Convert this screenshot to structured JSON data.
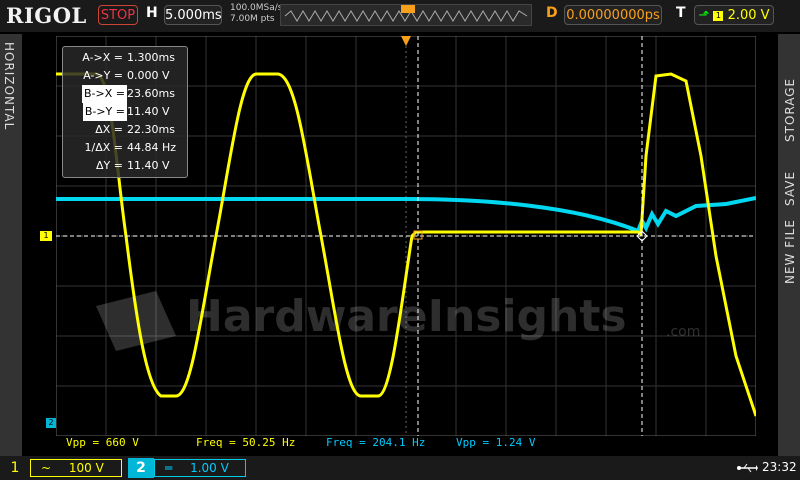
{
  "header": {
    "logo": "RIGOL",
    "run_state": "STOP",
    "h_label": "H",
    "timebase": "5.000ms",
    "sample_rate": "100.0MSa/s",
    "mem_depth": "7.00M pts",
    "d_label": "D",
    "delay": "0.00000000ps",
    "t_label": "T",
    "trigger_level": "2.00 V",
    "colors": {
      "stop": "#e33",
      "delay": "#f9a01a",
      "trigger": "#ffff00"
    }
  },
  "sidebar_left": {
    "label": "HORIZONTAL"
  },
  "sidebar_right": {
    "items": [
      "STORAGE",
      "SAVE",
      "NEW FILE"
    ]
  },
  "cursor_panel": {
    "rows": [
      {
        "label": "A->X =",
        "value": "1.300ms"
      },
      {
        "label": "A->Y =",
        "value": "0.000 V"
      },
      {
        "label": "B->X =",
        "value": "23.60ms"
      },
      {
        "label": "B->Y =",
        "value": "11.40 V"
      },
      {
        "label": "ΔX =",
        "value": "22.30ms"
      },
      {
        "label": "1/ΔX =",
        "value": "44.84 Hz"
      },
      {
        "label": "ΔY =",
        "value": "11.40 V"
      }
    ]
  },
  "watermark": {
    "text": "HardwareInsights",
    ".com": ".com",
    "suffix": ".com"
  },
  "measurements": [
    {
      "text": "Vpp = 660 V",
      "color": "#ffff00"
    },
    {
      "text": "Freq = 50.25 Hz",
      "color": "#ffff00"
    },
    {
      "text": "Freq = 204.1 Hz",
      "color": "#00d7f0"
    },
    {
      "text": "Vpp = 1.24 V",
      "color": "#00d7f0"
    }
  ],
  "channel_markers": {
    "ch1": "1",
    "ch2": "2"
  },
  "bottom": {
    "ch1": {
      "num": "1",
      "coupling": "~",
      "scale": "100 V",
      "color": "#ffff00"
    },
    "ch2": {
      "num": "2",
      "coupling": "═",
      "scale": "1.00 V",
      "color": "#00d7f0"
    },
    "time": "23:32"
  }
}
